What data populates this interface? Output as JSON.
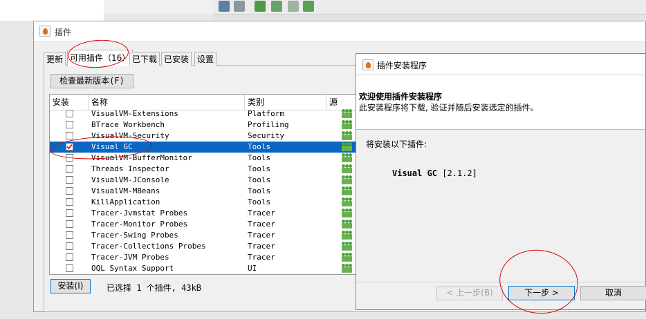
{
  "plugins_window": {
    "title": "插件",
    "tabs": [
      "更新",
      "可用插件（16）",
      "已下载",
      "已安装",
      "设置"
    ],
    "active_tab": 1,
    "check_updates_button": "检查最新版本(F)",
    "columns": [
      "安装",
      "名称",
      "类别",
      "源"
    ],
    "rows": [
      {
        "name": "VisualVM-Extensions",
        "category": "Platform",
        "checked": false,
        "selected": false
      },
      {
        "name": "BTrace Workbench",
        "category": "Profiling",
        "checked": false,
        "selected": false
      },
      {
        "name": "VisualVM-Security",
        "category": "Security",
        "checked": false,
        "selected": false
      },
      {
        "name": "Visual GC",
        "category": "Tools",
        "checked": true,
        "selected": true
      },
      {
        "name": "VisualVM-BufferMonitor",
        "category": "Tools",
        "checked": false,
        "selected": false
      },
      {
        "name": "Threads Inspector",
        "category": "Tools",
        "checked": false,
        "selected": false
      },
      {
        "name": "VisualVM-JConsole",
        "category": "Tools",
        "checked": false,
        "selected": false
      },
      {
        "name": "VisualVM-MBeans",
        "category": "Tools",
        "checked": false,
        "selected": false
      },
      {
        "name": "KillApplication",
        "category": "Tools",
        "checked": false,
        "selected": false
      },
      {
        "name": "Tracer-Jvmstat Probes",
        "category": "Tracer",
        "checked": false,
        "selected": false
      },
      {
        "name": "Tracer-Monitor Probes",
        "category": "Tracer",
        "checked": false,
        "selected": false
      },
      {
        "name": "Tracer-Swing Probes",
        "category": "Tracer",
        "checked": false,
        "selected": false
      },
      {
        "name": "Tracer-Collections Probes",
        "category": "Tracer",
        "checked": false,
        "selected": false
      },
      {
        "name": "Tracer-JVM Probes",
        "category": "Tracer",
        "checked": false,
        "selected": false
      },
      {
        "name": "OQL Syntax Support",
        "category": "UI",
        "checked": false,
        "selected": false
      }
    ],
    "install_button": "安装(I)",
    "status": "已选择 1 个插件, 43kB"
  },
  "install_dialog": {
    "title": "插件安装程序",
    "heading": "欢迎使用插件安装程序",
    "subheading": "此安装程序将下载, 验证并随后安装选定的插件。",
    "intro": "将安装以下插件:",
    "plugin_name": "Visual GC",
    "plugin_version": "[2.1.2]",
    "back_button": "< 上一步(B)",
    "next_button": "下一步 >",
    "cancel_button": "取消"
  },
  "colors": {
    "selection": "#0a66c2",
    "annotation": "#d80000",
    "focus_border": "#0078d7"
  }
}
